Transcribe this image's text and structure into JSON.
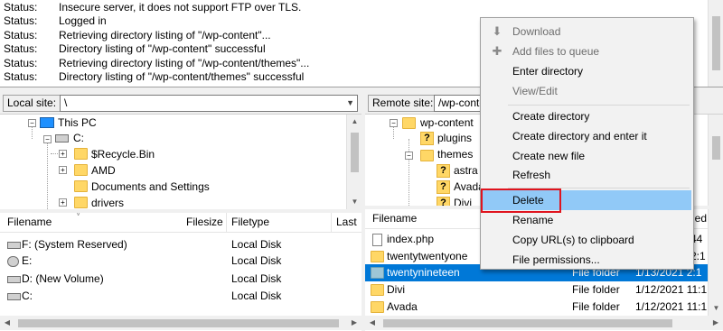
{
  "log": {
    "lines": [
      {
        "label": "Status:",
        "text": "Insecure server, it does not support FTP over TLS."
      },
      {
        "label": "Status:",
        "text": "Logged in"
      },
      {
        "label": "Status:",
        "text": "Retrieving directory listing of \"/wp-content\"..."
      },
      {
        "label": "Status:",
        "text": "Directory listing of \"/wp-content\" successful"
      },
      {
        "label": "Status:",
        "text": "Retrieving directory listing of \"/wp-content/themes\"..."
      },
      {
        "label": "Status:",
        "text": "Directory listing of \"/wp-content/themes\" successful"
      }
    ]
  },
  "local": {
    "site_label": "Local site:",
    "site_value": "\\",
    "tree": [
      "This PC",
      "C:",
      "$Recycle.Bin",
      "AMD",
      "Documents and Settings",
      "drivers"
    ],
    "columns": [
      "Filename",
      "Filesize",
      "Filetype",
      "Last"
    ],
    "rows": [
      {
        "name": "F: (System Reserved)",
        "type": "Local Disk"
      },
      {
        "name": "E:",
        "type": "Local Disk"
      },
      {
        "name": "D: (New Volume)",
        "type": "Local Disk"
      },
      {
        "name": "C:",
        "type": "Local Disk"
      }
    ]
  },
  "remote": {
    "site_label": "Remote site:",
    "site_value": "/wp-content",
    "tree": [
      "wp-content",
      "plugins",
      "themes",
      "astra",
      "Avada",
      "Divi"
    ],
    "columns": [
      "Filename",
      "ified"
    ],
    "rows": [
      {
        "name": "index.php",
        "type": "",
        "date": "44"
      },
      {
        "name": "twentytwentyone",
        "type": "",
        "date": "2:1"
      },
      {
        "name": "twentynineteen",
        "type": "File folder",
        "date": "1/13/2021 2:1"
      },
      {
        "name": "Divi",
        "type": "File folder",
        "date": "1/12/2021 11:1"
      },
      {
        "name": "Avada",
        "type": "File folder",
        "date": "1/12/2021 11:1"
      }
    ],
    "selected_row": "twentynineteen"
  },
  "context_menu": {
    "items": [
      {
        "label": "Download",
        "disabled": true,
        "icon": "download-arrow-icon"
      },
      {
        "label": "Add files to queue",
        "disabled": true,
        "icon": "add-to-queue-icon"
      },
      {
        "label": "Enter directory",
        "disabled": false
      },
      {
        "label": "View/Edit",
        "disabled": true
      },
      {
        "label": "Create directory",
        "disabled": false
      },
      {
        "label": "Create directory and enter it",
        "disabled": false
      },
      {
        "label": "Create new file",
        "disabled": false
      },
      {
        "label": "Refresh",
        "disabled": false
      },
      {
        "label": "Delete",
        "disabled": false,
        "highlighted": true
      },
      {
        "label": "Rename",
        "disabled": false
      },
      {
        "label": "Copy URL(s) to clipboard",
        "disabled": false
      },
      {
        "label": "File permissions...",
        "disabled": false
      }
    ]
  },
  "colors": {
    "selection": "#0078d7",
    "menu_highlight": "#91c9f7",
    "callout": "#e0141e",
    "folder": "#ffd766"
  }
}
